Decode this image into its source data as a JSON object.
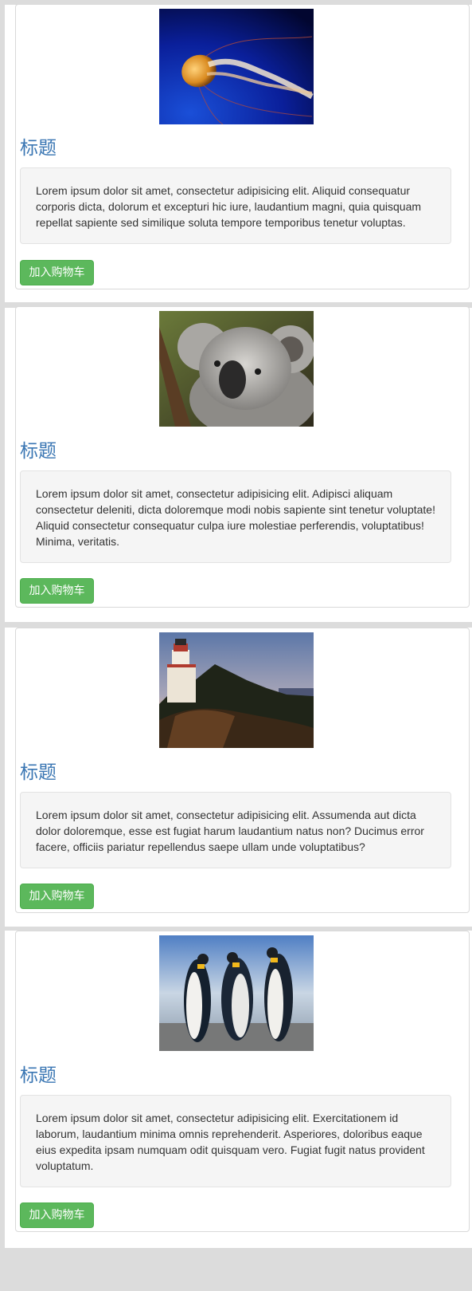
{
  "products": [
    {
      "image_icon": "jellyfish-image",
      "title": "标题",
      "description": "Lorem ipsum dolor sit amet, consectetur adipisicing elit. Aliquid consequatur corporis dicta, dolorum et excepturi hic iure, laudantium magni, quia quisquam repellat sapiente sed similique soluta tempore temporibus tenetur voluptas.",
      "button_label": "加入购物车"
    },
    {
      "image_icon": "koala-image",
      "title": "标题",
      "description": "Lorem ipsum dolor sit amet, consectetur adipisicing elit. Adipisci aliquam consectetur deleniti, dicta doloremque modi nobis sapiente sint tenetur voluptate! Aliquid consectetur consequatur culpa iure molestiae perferendis, voluptatibus! Minima, veritatis.",
      "button_label": "加入购物车"
    },
    {
      "image_icon": "lighthouse-image",
      "title": "标题",
      "description": "Lorem ipsum dolor sit amet, consectetur adipisicing elit. Assumenda aut dicta dolor doloremque, esse est fugiat harum laudantium natus non? Ducimus error facere, officiis pariatur repellendus saepe ullam unde voluptatibus?",
      "button_label": "加入购物车"
    },
    {
      "image_icon": "penguins-image",
      "title": "标题",
      "description": "Lorem ipsum dolor sit amet, consectetur adipisicing elit. Exercitationem id laborum, laudantium minima omnis reprehenderit. Asperiores, doloribus eaque eius expedita ipsam numquam odit quisquam vero. Fugiat fugit natus provident voluptatum.",
      "button_label": "加入购物车"
    }
  ],
  "colors": {
    "title": "#3a76b3",
    "button": "#5cb85c",
    "well": "#f5f5f5",
    "background": "#dcdcdc"
  }
}
